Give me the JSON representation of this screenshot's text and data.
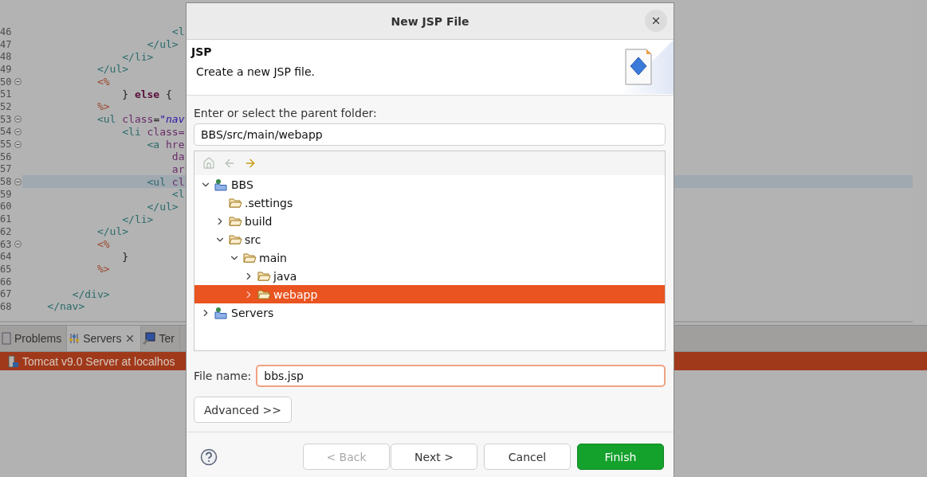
{
  "editor": {
    "lines": [
      {
        "number": "46",
        "foldable": false,
        "current": false,
        "tokens": [
          {
            "kind": "tag",
            "text": "\t\t\t\t\t\t<l"
          }
        ]
      },
      {
        "number": "47",
        "foldable": false,
        "current": false,
        "tokens": [
          {
            "kind": "tag",
            "text": "\t\t\t\t\t</ul>"
          }
        ]
      },
      {
        "number": "48",
        "foldable": false,
        "current": false,
        "tokens": [
          {
            "kind": "tag",
            "text": "\t\t\t\t</li>"
          }
        ]
      },
      {
        "number": "49",
        "foldable": false,
        "current": false,
        "tokens": [
          {
            "kind": "tag",
            "text": "\t\t\t</ul>"
          }
        ]
      },
      {
        "number": "50",
        "foldable": true,
        "current": false,
        "tokens": [
          {
            "kind": "jsp",
            "text": "\t\t\t<%"
          }
        ]
      },
      {
        "number": "51",
        "foldable": false,
        "current": false,
        "tokens": [
          {
            "kind": "plain",
            "text": "\t\t\t\t} "
          },
          {
            "kind": "keyword",
            "text": "else"
          },
          {
            "kind": "plain",
            "text": " {"
          }
        ]
      },
      {
        "number": "52",
        "foldable": false,
        "current": false,
        "tokens": [
          {
            "kind": "jsp",
            "text": "\t\t\t%>"
          }
        ]
      },
      {
        "number": "53",
        "foldable": true,
        "current": false,
        "tokens": [
          {
            "kind": "tag",
            "text": "\t\t\t<ul "
          },
          {
            "kind": "attr",
            "text": "class"
          },
          {
            "kind": "plain",
            "text": "="
          },
          {
            "kind": "string",
            "text": "\"nav"
          }
        ]
      },
      {
        "number": "54",
        "foldable": true,
        "current": false,
        "tokens": [
          {
            "kind": "tag",
            "text": "\t\t\t\t<li "
          },
          {
            "kind": "attr",
            "text": "class="
          }
        ]
      },
      {
        "number": "55",
        "foldable": true,
        "current": false,
        "tokens": [
          {
            "kind": "tag",
            "text": "\t\t\t\t\t<a "
          },
          {
            "kind": "attr",
            "text": "hre"
          }
        ]
      },
      {
        "number": "56",
        "foldable": false,
        "current": false,
        "tokens": [
          {
            "kind": "attr",
            "text": "\t\t\t\t\t\tda"
          }
        ]
      },
      {
        "number": "57",
        "foldable": false,
        "current": false,
        "tokens": [
          {
            "kind": "attr",
            "text": "\t\t\t\t\t\tar"
          }
        ]
      },
      {
        "number": "58",
        "foldable": true,
        "current": true,
        "tokens": [
          {
            "kind": "tag",
            "text": "\t\t\t\t\t<ul "
          },
          {
            "kind": "attr",
            "text": "cl"
          }
        ]
      },
      {
        "number": "59",
        "foldable": false,
        "current": false,
        "tokens": [
          {
            "kind": "tag",
            "text": "\t\t\t\t\t\t<l"
          }
        ]
      },
      {
        "number": "60",
        "foldable": false,
        "current": false,
        "tokens": [
          {
            "kind": "tag",
            "text": "\t\t\t\t\t</ul>"
          }
        ]
      },
      {
        "number": "61",
        "foldable": false,
        "current": false,
        "tokens": [
          {
            "kind": "tag",
            "text": "\t\t\t\t</li>"
          }
        ]
      },
      {
        "number": "62",
        "foldable": false,
        "current": false,
        "tokens": [
          {
            "kind": "tag",
            "text": "\t\t\t</ul>"
          }
        ]
      },
      {
        "number": "63",
        "foldable": true,
        "current": false,
        "tokens": [
          {
            "kind": "jsp",
            "text": "\t\t\t<%"
          }
        ]
      },
      {
        "number": "64",
        "foldable": false,
        "current": false,
        "tokens": [
          {
            "kind": "plain",
            "text": "\t\t\t\t}"
          }
        ]
      },
      {
        "number": "65",
        "foldable": false,
        "current": false,
        "tokens": [
          {
            "kind": "jsp",
            "text": "\t\t\t%>"
          }
        ]
      },
      {
        "number": "66",
        "foldable": false,
        "current": false
      },
      {
        "number": "67",
        "foldable": false,
        "current": false,
        "tokens": [
          {
            "kind": "tag",
            "text": "\t\t</div>"
          }
        ]
      },
      {
        "number": "68",
        "foldable": false,
        "current": false,
        "tokens": [
          {
            "kind": "tag",
            "text": "\t</nav>"
          }
        ]
      }
    ]
  },
  "bottom_panel": {
    "tabs": [
      {
        "kind": "problems",
        "label": "Problems",
        "selected": false,
        "closable": false
      },
      {
        "kind": "servers",
        "label": "Servers",
        "selected": true,
        "closable": true
      },
      {
        "kind": "terminal",
        "label": "Ter",
        "selected": false,
        "closable": false
      }
    ],
    "servers": [
      {
        "label": "Tomcat v9.0 Server at localhos",
        "selected": true
      }
    ]
  },
  "dialog": {
    "title": "New JSP File",
    "header": {
      "title": "JSP",
      "description": "Create a new JSP file."
    },
    "folder_label": "Enter or select the parent folder:",
    "folder_value": "BBS/src/main/webapp",
    "tree_toolbar": [
      {
        "kind": "home",
        "disabled": true
      },
      {
        "kind": "back",
        "disabled": true
      },
      {
        "kind": "forward",
        "disabled": false
      }
    ],
    "tree": [
      {
        "label": "BBS",
        "kind": "project",
        "expandable": true,
        "expanded": true,
        "selected": false,
        "children": [
          {
            "label": ".settings",
            "kind": "folder",
            "expandable": false,
            "selected": false
          },
          {
            "label": "build",
            "kind": "folder",
            "expandable": true,
            "expanded": false,
            "selected": false
          },
          {
            "label": "src",
            "kind": "folder",
            "expandable": true,
            "expanded": true,
            "selected": false,
            "children": [
              {
                "label": "main",
                "kind": "folder",
                "expandable": true,
                "expanded": true,
                "selected": false,
                "children": [
                  {
                    "label": "java",
                    "kind": "folder",
                    "expandable": true,
                    "expanded": false,
                    "selected": false
                  },
                  {
                    "label": "webapp",
                    "kind": "folder",
                    "expandable": true,
                    "expanded": false,
                    "selected": true
                  }
                ]
              }
            ]
          }
        ]
      },
      {
        "label": "Servers",
        "kind": "project",
        "expandable": true,
        "expanded": false,
        "selected": false
      }
    ],
    "file_name_label": "File name:",
    "file_name_value": "bbs.jsp",
    "file_name_focused": true,
    "advanced_button": "Advanced >>",
    "buttons": [
      {
        "label": "< Back",
        "kind": "default",
        "disabled": true
      },
      {
        "label": "Next >",
        "kind": "default",
        "disabled": false
      },
      {
        "label": "Cancel",
        "kind": "default",
        "disabled": false
      },
      {
        "label": "Finish",
        "kind": "primary",
        "disabled": false
      }
    ]
  }
}
